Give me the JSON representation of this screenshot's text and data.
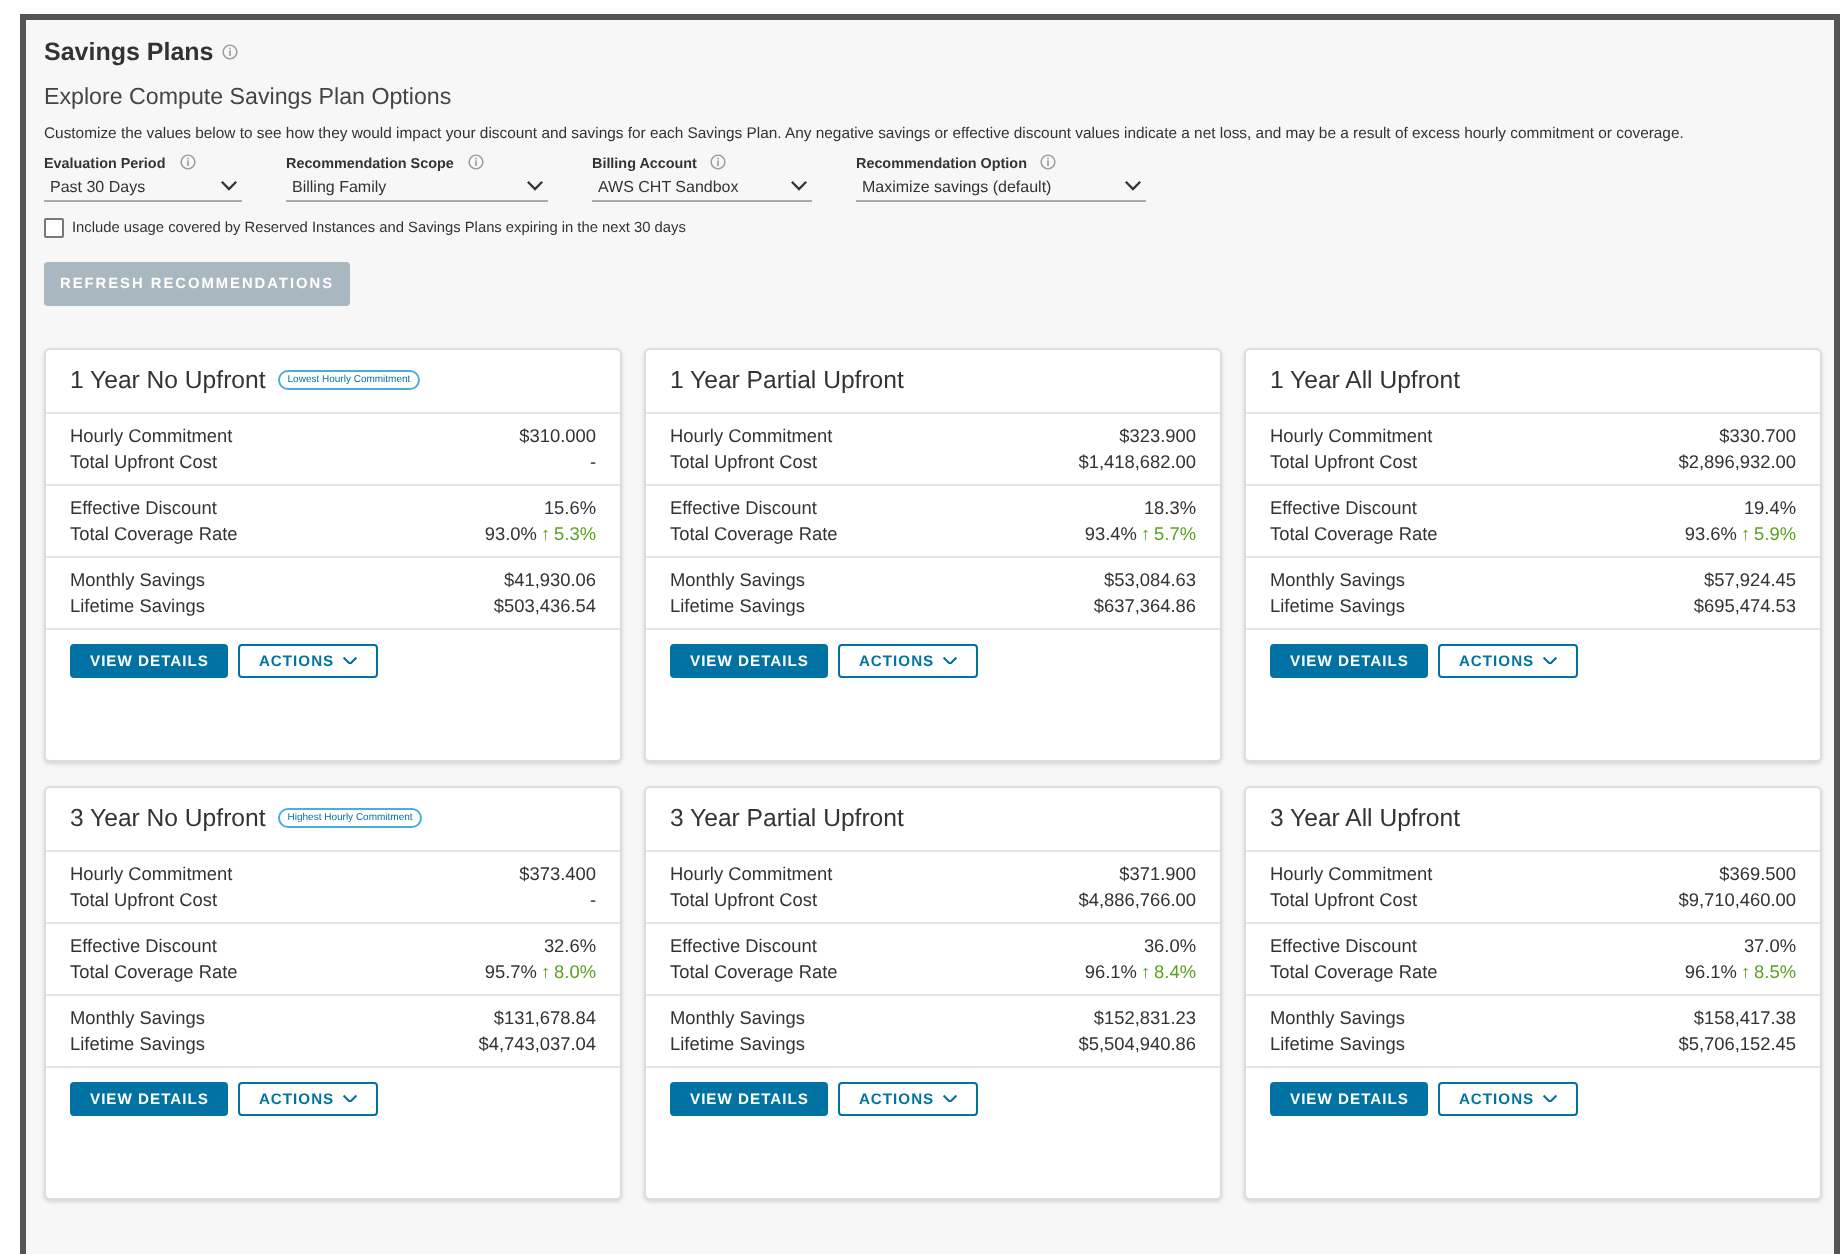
{
  "title": "Savings Plans",
  "subtitle": "Explore Compute Savings Plan Options",
  "description": "Customize the values below to see how they would impact your discount and savings for each Savings Plan. Any negative savings or effective discount values indicate a net loss, and may be a result of excess hourly commitment or coverage.",
  "filters": [
    {
      "label": "Evaluation Period",
      "value": "Past 30 Days"
    },
    {
      "label": "Recommendation Scope",
      "value": "Billing Family"
    },
    {
      "label": "Billing Account",
      "value": "AWS CHT Sandbox"
    },
    {
      "label": "Recommendation Option",
      "value": "Maximize savings (default)"
    }
  ],
  "include_expiring": {
    "label": "Include usage covered by Reserved Instances and Savings Plans expiring in the next 30 days",
    "checked": false
  },
  "refresh_button": {
    "label": "REFRESH RECOMMENDATIONS",
    "disabled": true
  },
  "plans": [
    {
      "title": "1 Year No Upfront",
      "badge": "Lowest Hourly Commitment",
      "sections": [
        [
          {
            "label": "Hourly Commitment",
            "value": "$310.000"
          },
          {
            "label": "Total Upfront Cost",
            "value": "-"
          }
        ],
        [
          {
            "label": "Effective Discount",
            "value": "15.6%"
          },
          {
            "label": "Total Coverage Rate",
            "value": "93.0%",
            "arrow": "↑",
            "change": "5.3%"
          }
        ],
        [
          {
            "label": "Monthly Savings",
            "value": "$41,930.06"
          },
          {
            "label": "Lifetime Savings",
            "value": "$503,436.54"
          }
        ]
      ],
      "primary_button": "VIEW DETAILS",
      "menu_button": "ACTIONS"
    },
    {
      "title": "1 Year Partial Upfront",
      "sections": [
        [
          {
            "label": "Hourly Commitment",
            "value": "$323.900"
          },
          {
            "label": "Total Upfront Cost",
            "value": "$1,418,682.00"
          }
        ],
        [
          {
            "label": "Effective Discount",
            "value": "18.3%"
          },
          {
            "label": "Total Coverage Rate",
            "value": "93.4%",
            "arrow": "↑",
            "change": "5.7%"
          }
        ],
        [
          {
            "label": "Monthly Savings",
            "value": "$53,084.63"
          },
          {
            "label": "Lifetime Savings",
            "value": "$637,364.86"
          }
        ]
      ],
      "primary_button": "VIEW DETAILS",
      "menu_button": "ACTIONS"
    },
    {
      "title": "1 Year All Upfront",
      "sections": [
        [
          {
            "label": "Hourly Commitment",
            "value": "$330.700"
          },
          {
            "label": "Total Upfront Cost",
            "value": "$2,896,932.00"
          }
        ],
        [
          {
            "label": "Effective Discount",
            "value": "19.4%"
          },
          {
            "label": "Total Coverage Rate",
            "value": "93.6%",
            "arrow": "↑",
            "change": "5.9%"
          }
        ],
        [
          {
            "label": "Monthly Savings",
            "value": "$57,924.45"
          },
          {
            "label": "Lifetime Savings",
            "value": "$695,474.53"
          }
        ]
      ],
      "primary_button": "VIEW DETAILS",
      "menu_button": "ACTIONS"
    },
    {
      "title": "3 Year No Upfront",
      "badge": "Highest Hourly Commitment",
      "sections": [
        [
          {
            "label": "Hourly Commitment",
            "value": "$373.400"
          },
          {
            "label": "Total Upfront Cost",
            "value": "-"
          }
        ],
        [
          {
            "label": "Effective Discount",
            "value": "32.6%"
          },
          {
            "label": "Total Coverage Rate",
            "value": "95.7%",
            "arrow": "↑",
            "change": "8.0%"
          }
        ],
        [
          {
            "label": "Monthly Savings",
            "value": "$131,678.84"
          },
          {
            "label": "Lifetime Savings",
            "value": "$4,743,037.04"
          }
        ]
      ],
      "primary_button": "VIEW DETAILS",
      "menu_button": "ACTIONS"
    },
    {
      "title": "3 Year Partial Upfront",
      "sections": [
        [
          {
            "label": "Hourly Commitment",
            "value": "$371.900"
          },
          {
            "label": "Total Upfront Cost",
            "value": "$4,886,766.00"
          }
        ],
        [
          {
            "label": "Effective Discount",
            "value": "36.0%"
          },
          {
            "label": "Total Coverage Rate",
            "value": "96.1%",
            "arrow": "↑",
            "change": "8.4%"
          }
        ],
        [
          {
            "label": "Monthly Savings",
            "value": "$152,831.23"
          },
          {
            "label": "Lifetime Savings",
            "value": "$5,504,940.86"
          }
        ]
      ],
      "primary_button": "VIEW DETAILS",
      "menu_button": "ACTIONS"
    },
    {
      "title": "3 Year All Upfront",
      "sections": [
        [
          {
            "label": "Hourly Commitment",
            "value": "$369.500"
          },
          {
            "label": "Total Upfront Cost",
            "value": "$9,710,460.00"
          }
        ],
        [
          {
            "label": "Effective Discount",
            "value": "37.0%"
          },
          {
            "label": "Total Coverage Rate",
            "value": "96.1%",
            "arrow": "↑",
            "change": "8.5%"
          }
        ],
        [
          {
            "label": "Monthly Savings",
            "value": "$158,417.38"
          },
          {
            "label": "Lifetime Savings",
            "value": "$5,706,152.45"
          }
        ]
      ],
      "primary_button": "VIEW DETAILS",
      "menu_button": "ACTIONS"
    }
  ]
}
